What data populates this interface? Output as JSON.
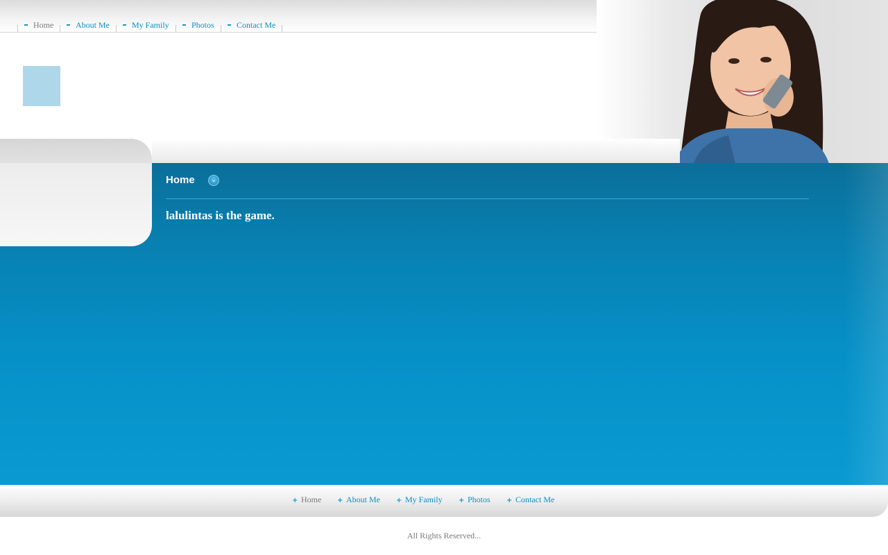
{
  "top_nav": {
    "items": [
      {
        "label": "Home",
        "active": true
      },
      {
        "label": "About Me",
        "active": false
      },
      {
        "label": "My Family",
        "active": false
      },
      {
        "label": "Photos",
        "active": false
      },
      {
        "label": "Contact Me",
        "active": false
      }
    ]
  },
  "content": {
    "title": "Home",
    "toggle_icon": "chevron-down-icon",
    "body_text": "lalulintas is the game."
  },
  "footer_nav": {
    "items": [
      {
        "label": "Home",
        "active": true
      },
      {
        "label": "About Me",
        "active": false
      },
      {
        "label": "My Family",
        "active": false
      },
      {
        "label": "Photos",
        "active": false
      },
      {
        "label": "Contact Me",
        "active": false
      }
    ]
  },
  "footer": {
    "copyright": "All Rights Reserved..."
  },
  "colors": {
    "accent_blue": "#0a8fc4",
    "main_blue": "#0591c8",
    "logo_placeholder": "#aed8ea",
    "inactive_text": "#7a7a7a"
  }
}
